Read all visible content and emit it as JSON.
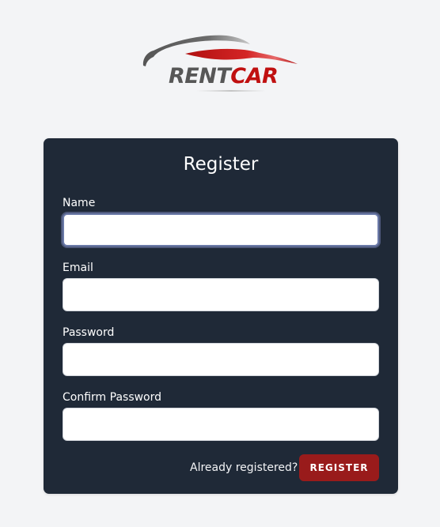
{
  "brand": {
    "logo_text_primary": "RENT",
    "logo_text_accent": "CAR",
    "primary_color": "#575757",
    "accent_color": "#c01010"
  },
  "form": {
    "title": "Register",
    "fields": [
      {
        "label": "Name",
        "value": "",
        "focused": true
      },
      {
        "label": "Email",
        "value": ""
      },
      {
        "label": "Password",
        "value": ""
      },
      {
        "label": "Confirm Password",
        "value": ""
      }
    ],
    "login_link": "Already registered?",
    "submit_label": "REGISTER"
  },
  "colors": {
    "page_background": "#f3f4f6",
    "card_background": "#1f2937",
    "button_background": "#991b1b"
  }
}
